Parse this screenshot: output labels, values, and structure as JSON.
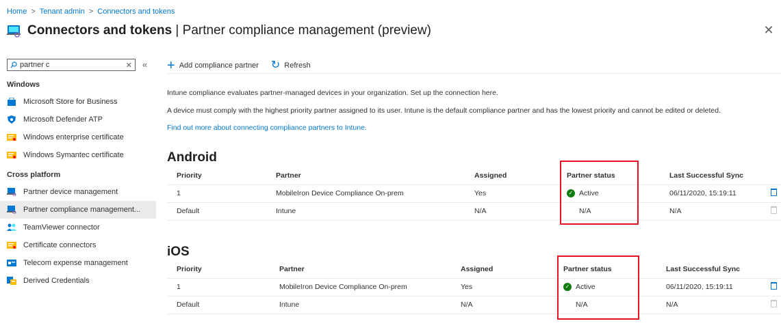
{
  "breadcrumb": {
    "home": "Home",
    "tenant_admin": "Tenant admin",
    "current": "Connectors and tokens",
    "sep": ">"
  },
  "header": {
    "title_bold": "Connectors and tokens",
    "title_rest": " | Partner compliance management (preview)",
    "close": "✕"
  },
  "search": {
    "value": "partner c",
    "placeholder": "Search",
    "clear": "✕",
    "collapse": "«"
  },
  "sidebar": {
    "sections": [
      {
        "header": "Windows",
        "items": [
          {
            "label": "Microsoft Store for Business",
            "icon": "store-icon"
          },
          {
            "label": "Microsoft Defender ATP",
            "icon": "shield-icon"
          },
          {
            "label": "Windows enterprise certificate",
            "icon": "certificate-icon"
          },
          {
            "label": "Windows Symantec certificate",
            "icon": "certificate-icon"
          }
        ]
      },
      {
        "header": "Cross platform",
        "items": [
          {
            "label": "Partner device management",
            "icon": "device-icon"
          },
          {
            "label": "Partner compliance management...",
            "icon": "device-icon",
            "selected": true
          },
          {
            "label": "TeamViewer connector",
            "icon": "people-icon"
          },
          {
            "label": "Certificate connectors",
            "icon": "certificate-icon"
          },
          {
            "label": "Telecom expense management",
            "icon": "telecom-icon"
          },
          {
            "label": "Derived Credentials",
            "icon": "credentials-icon"
          }
        ]
      }
    ]
  },
  "toolbar": {
    "add_label": "Add compliance partner",
    "refresh_label": "Refresh"
  },
  "description": {
    "line1": "Intune compliance evaluates partner-managed devices in your organization. Set up the connection here.",
    "line2": "A device must comply with the highest priority partner assigned to its user. Intune is the default compliance partner and has the lowest priority and cannot be edited or deleted.",
    "link": "Find out more about connecting compliance partners to Intune."
  },
  "columns": {
    "priority": "Priority",
    "partner": "Partner",
    "assigned": "Assigned",
    "status": "Partner status",
    "sync": "Last Successful Sync"
  },
  "android": {
    "title": "Android",
    "rows": [
      {
        "priority": "1",
        "partner": "MobileIron Device Compliance On-prem",
        "assigned": "Yes",
        "status": "Active",
        "sync": "06/11/2020, 15:19:11"
      },
      {
        "priority": "Default",
        "partner": "Intune",
        "assigned": "N/A",
        "status": "N/A",
        "sync": "N/A"
      }
    ]
  },
  "ios": {
    "title": "iOS",
    "rows": [
      {
        "priority": "1",
        "partner": "MobileIron Device Compliance On-prem",
        "assigned": "Yes",
        "status": "Active",
        "sync": "06/11/2020, 15:19:11"
      },
      {
        "priority": "Default",
        "partner": "Intune",
        "assigned": "N/A",
        "status": "N/A",
        "sync": "N/A"
      }
    ]
  },
  "colors": {
    "accent": "#0078d4",
    "active": "#107c10",
    "highlight": "#e81123"
  }
}
